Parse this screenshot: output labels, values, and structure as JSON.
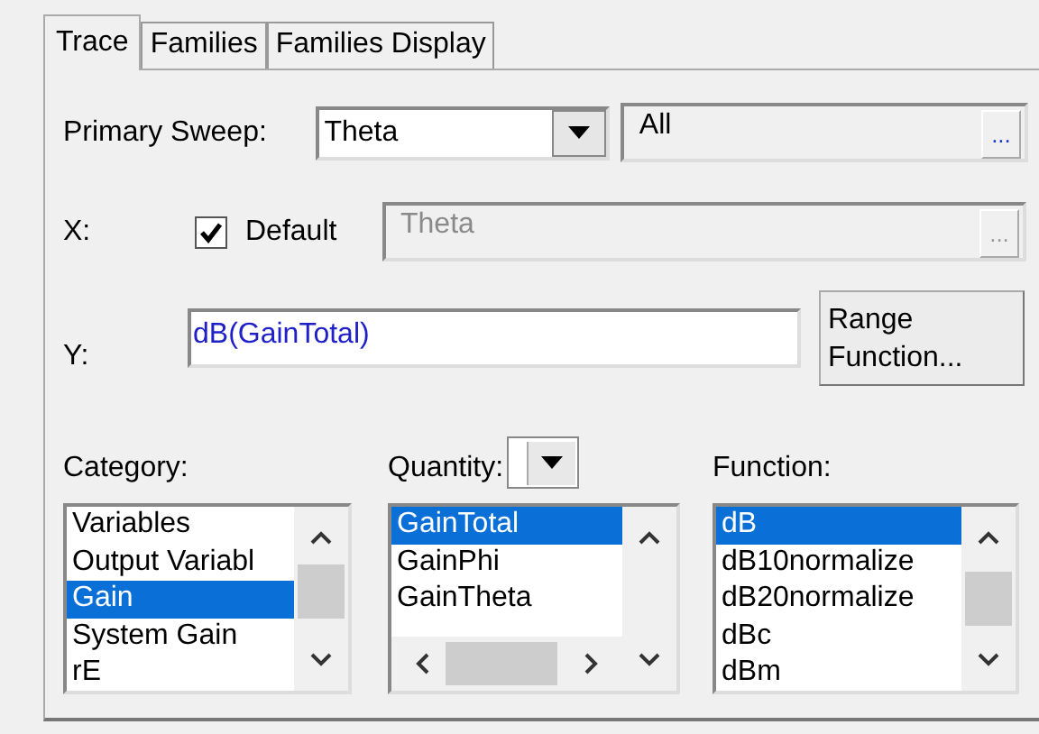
{
  "tabs": [
    {
      "label": "Trace",
      "selected": true
    },
    {
      "label": "Families",
      "selected": false
    },
    {
      "label": "Families Display",
      "selected": false
    }
  ],
  "primary_sweep": {
    "label": "Primary Sweep:",
    "value": "Theta",
    "range": "All",
    "range_button": "..."
  },
  "x": {
    "label": "X:",
    "default_checked": true,
    "default_label": "Default",
    "value": "Theta",
    "disabled": true,
    "button": "..."
  },
  "y": {
    "label": "Y:",
    "value": "dB(GainTotal)",
    "button": "Range Function..."
  },
  "category": {
    "label": "Category:",
    "items": [
      {
        "label": "Variables",
        "selected": false
      },
      {
        "label": "Output Variabl",
        "selected": false
      },
      {
        "label": "Gain",
        "selected": true
      },
      {
        "label": "System Gain",
        "selected": false
      },
      {
        "label": "rE",
        "selected": false
      }
    ]
  },
  "quantity": {
    "label": "Quantity:",
    "items": [
      {
        "label": "GainTotal",
        "selected": true
      },
      {
        "label": "GainPhi",
        "selected": false
      },
      {
        "label": "GainTheta",
        "selected": false
      }
    ]
  },
  "function": {
    "label": "Function:",
    "items": [
      {
        "label": "dB",
        "selected": true
      },
      {
        "label": "dB10normalize",
        "selected": false
      },
      {
        "label": "dB20normalize",
        "selected": false
      },
      {
        "label": "dBc",
        "selected": false
      },
      {
        "label": "dBm",
        "selected": false
      }
    ]
  }
}
